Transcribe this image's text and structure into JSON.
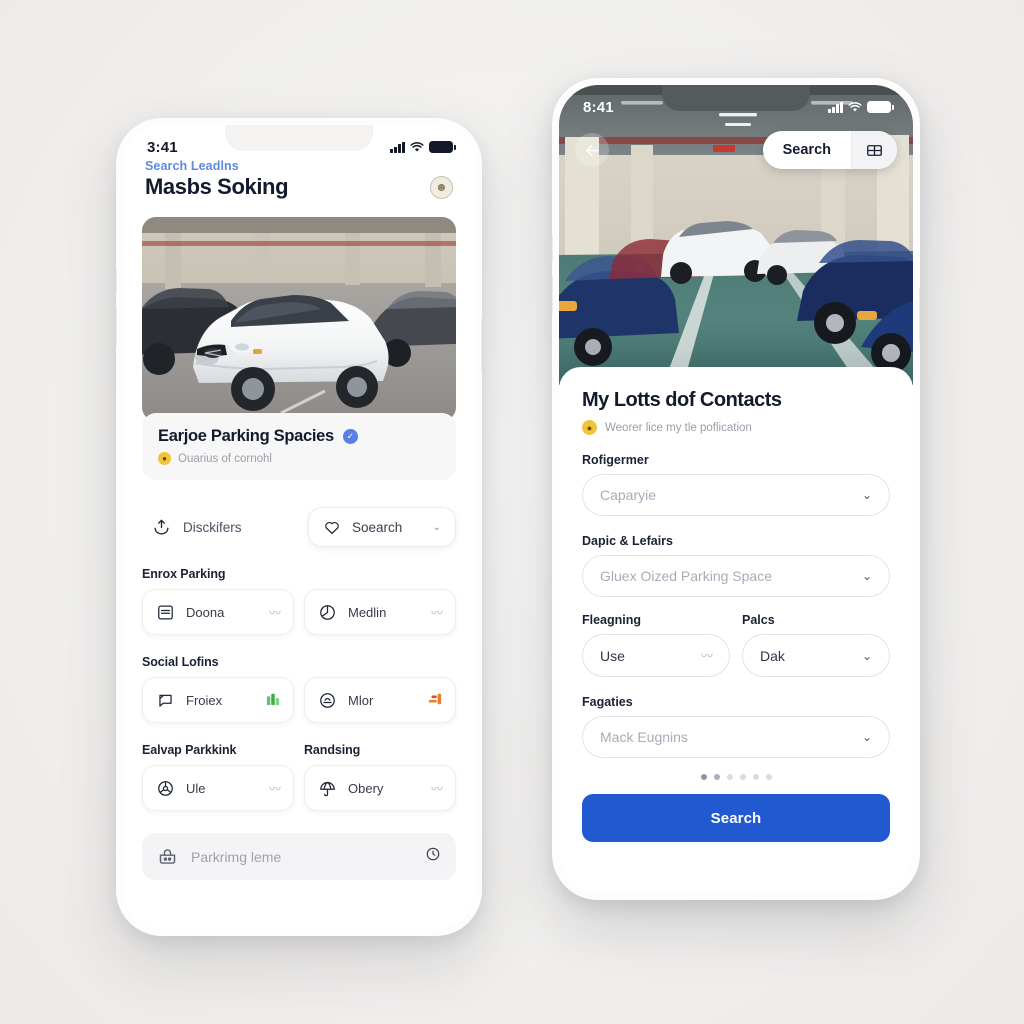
{
  "left_phone": {
    "status": {
      "time": "3:41",
      "signal_icon": "cellular-bars-icon",
      "wifi_icon": "wifi-icon",
      "battery_icon": "battery-full-icon"
    },
    "header": {
      "kicker": "Search Leadlns",
      "title": "Masbs Soking",
      "avatar_icon": "user-avatar-icon"
    },
    "hero_image": {
      "name": "white-suv-in-parking-garage-photo"
    },
    "info_card": {
      "title": "Earjoe Parking Spacies",
      "badge_icon": "verified-badge-icon",
      "subtitle_emoji": "coin-emoji",
      "subtitle": "Ouarius of cornohl"
    },
    "action_row": {
      "plain": {
        "icon": "upload-tray-icon",
        "label": "Disckifers"
      },
      "pill": {
        "icon": "heart-icon",
        "label": "Soearch",
        "caret": "⌄"
      }
    },
    "sections": [
      {
        "label": "Enrox Parking",
        "tiles": [
          {
            "icon": "inbox-tray-icon",
            "label": "Doona",
            "trail": "〰",
            "trail_kind": "squiggle"
          },
          {
            "icon": "pie-chart-icon",
            "label": "Medlin",
            "trail": "〰",
            "trail_kind": "squiggle"
          }
        ]
      },
      {
        "label": "Social Lofins",
        "tiles": [
          {
            "icon": "chat-bubble-icon",
            "label": "Froiex",
            "trail": "📊",
            "trail_kind": "glyph"
          },
          {
            "icon": "circle-bank-icon",
            "label": "Mlor",
            "trail": "📑",
            "trail_kind": "glyph"
          }
        ]
      }
    ],
    "section_pair": {
      "labels": [
        "Ealvap Parkkink",
        "Randsing"
      ],
      "tiles": [
        {
          "icon": "steering-wheel-icon",
          "label": "Ule",
          "trail": "〰",
          "trail_kind": "squiggle"
        },
        {
          "icon": "umbrella-icon",
          "label": "Obery",
          "trail": "〰",
          "trail_kind": "squiggle"
        }
      ]
    },
    "bottom_field": {
      "icon": "parking-bag-icon",
      "placeholder": "Parkrimg leme",
      "trailing_icon": "clock-icon"
    }
  },
  "right_phone": {
    "status": {
      "time": "8:41",
      "signal_icon": "cellular-bars-icon",
      "wifi_icon": "wifi-icon",
      "battery_icon": "battery-full-icon"
    },
    "topbar": {
      "back_icon": "back-arrow-icon",
      "search_label": "Search",
      "grid_icon": "grid-layout-icon"
    },
    "photo": {
      "name": "indoor-parking-garage-aisle-photo"
    },
    "sheet": {
      "title": "My Lotts dof Contacts",
      "subtitle_emoji": "coin-emoji",
      "subtitle": "Weorer lice my tle poflication",
      "fields": [
        {
          "label": "Rofigermer",
          "value": "Caparyie",
          "caret": "⌄",
          "caret_kind": "chevron"
        },
        {
          "label": "Dapic & Lefairs",
          "value": "Gluex Oized Parking Space",
          "caret": "⌄",
          "caret_kind": "chevron"
        }
      ],
      "field_pair": [
        {
          "label": "Fleagning",
          "value": "Use",
          "caret": "〰",
          "caret_kind": "squiggle"
        },
        {
          "label": "Palcs",
          "value": "Dak",
          "caret": "⌄",
          "caret_kind": "chevron"
        }
      ],
      "last_field": {
        "label": "Fagaties",
        "value": "Mack Eugnins",
        "caret": "⌄",
        "caret_kind": "chevron"
      },
      "pager": {
        "total": 6,
        "active": 1,
        "second": 2
      },
      "primary_button": "Search"
    }
  },
  "colors": {
    "accent_blue": "#2059d0",
    "kicker_blue": "#5b8ae0",
    "badge_blue": "#5b7fe4",
    "page_bg": "#f2f1f0",
    "text_dark": "#141a2e",
    "text_muted": "#9ea2ad"
  }
}
